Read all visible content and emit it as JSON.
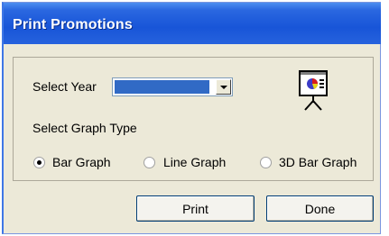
{
  "window": {
    "title": "Print Promotions"
  },
  "form": {
    "year_label": "Select Year",
    "year_value": "",
    "graph_type_label": "Select Graph Type",
    "graph_types": [
      {
        "label": "Bar Graph",
        "checked": true
      },
      {
        "label": "Line Graph",
        "checked": false
      },
      {
        "label": "3D Bar Graph",
        "checked": false
      }
    ]
  },
  "buttons": {
    "print_label": "Print",
    "done_label": "Done"
  },
  "icons": {
    "presentation": "presentation-chart-icon",
    "dropdown": "chevron-down-icon"
  },
  "colors": {
    "titlebar": "#1855d8",
    "selection": "#316ac5",
    "window_bg": "#ece9d8"
  }
}
